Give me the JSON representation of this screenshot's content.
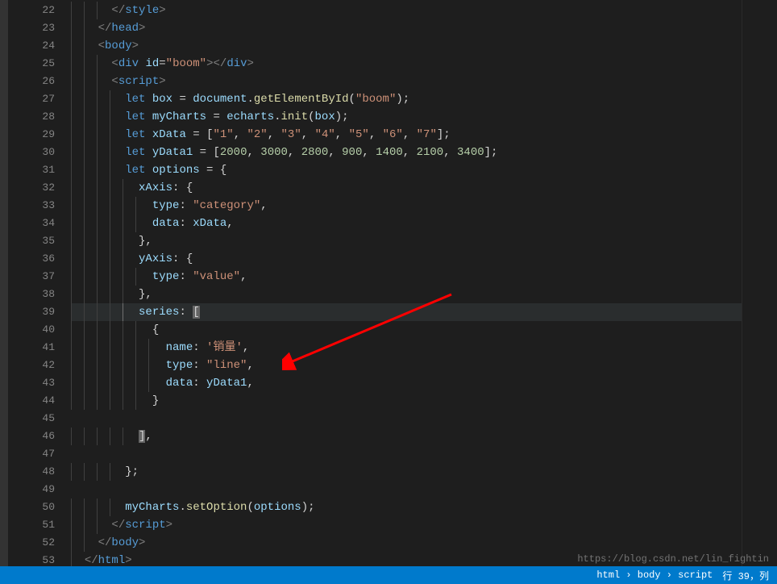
{
  "lines": [
    {
      "num": 22,
      "indent": 3,
      "tokens": [
        {
          "t": "tag",
          "v": "</"
        },
        {
          "t": "tagname",
          "v": "style"
        },
        {
          "t": "tag",
          "v": ">"
        }
      ]
    },
    {
      "num": 23,
      "indent": 2,
      "tokens": [
        {
          "t": "tag",
          "v": "</"
        },
        {
          "t": "tagname",
          "v": "head"
        },
        {
          "t": "tag",
          "v": ">"
        }
      ]
    },
    {
      "num": 24,
      "indent": 2,
      "tokens": [
        {
          "t": "tag",
          "v": "<"
        },
        {
          "t": "tagname",
          "v": "body"
        },
        {
          "t": "tag",
          "v": ">"
        }
      ]
    },
    {
      "num": 25,
      "indent": 3,
      "tokens": [
        {
          "t": "tag",
          "v": "<"
        },
        {
          "t": "tagname",
          "v": "div"
        },
        {
          "t": "punct",
          "v": " "
        },
        {
          "t": "attr",
          "v": "id"
        },
        {
          "t": "punct",
          "v": "="
        },
        {
          "t": "string",
          "v": "\"boom\""
        },
        {
          "t": "tag",
          "v": "></"
        },
        {
          "t": "tagname",
          "v": "div"
        },
        {
          "t": "tag",
          "v": ">"
        }
      ]
    },
    {
      "num": 26,
      "indent": 3,
      "tokens": [
        {
          "t": "tag",
          "v": "<"
        },
        {
          "t": "tagname",
          "v": "script"
        },
        {
          "t": "tag",
          "v": ">"
        }
      ]
    },
    {
      "num": 27,
      "indent": 4,
      "tokens": [
        {
          "t": "keyword",
          "v": "let"
        },
        {
          "t": "punct",
          "v": " "
        },
        {
          "t": "var",
          "v": "box"
        },
        {
          "t": "punct",
          "v": " = "
        },
        {
          "t": "var",
          "v": "document"
        },
        {
          "t": "punct",
          "v": "."
        },
        {
          "t": "func",
          "v": "getElementById"
        },
        {
          "t": "punct",
          "v": "("
        },
        {
          "t": "string",
          "v": "\"boom\""
        },
        {
          "t": "punct",
          "v": ");"
        }
      ]
    },
    {
      "num": 28,
      "indent": 4,
      "tokens": [
        {
          "t": "keyword",
          "v": "let"
        },
        {
          "t": "punct",
          "v": " "
        },
        {
          "t": "var",
          "v": "myCharts"
        },
        {
          "t": "punct",
          "v": " = "
        },
        {
          "t": "var",
          "v": "echarts"
        },
        {
          "t": "punct",
          "v": "."
        },
        {
          "t": "func",
          "v": "init"
        },
        {
          "t": "punct",
          "v": "("
        },
        {
          "t": "var",
          "v": "box"
        },
        {
          "t": "punct",
          "v": ");"
        }
      ]
    },
    {
      "num": 29,
      "indent": 4,
      "tokens": [
        {
          "t": "keyword",
          "v": "let"
        },
        {
          "t": "punct",
          "v": " "
        },
        {
          "t": "var",
          "v": "xData"
        },
        {
          "t": "punct",
          "v": " = ["
        },
        {
          "t": "string",
          "v": "\"1\""
        },
        {
          "t": "punct",
          "v": ", "
        },
        {
          "t": "string",
          "v": "\"2\""
        },
        {
          "t": "punct",
          "v": ", "
        },
        {
          "t": "string",
          "v": "\"3\""
        },
        {
          "t": "punct",
          "v": ", "
        },
        {
          "t": "string",
          "v": "\"4\""
        },
        {
          "t": "punct",
          "v": ", "
        },
        {
          "t": "string",
          "v": "\"5\""
        },
        {
          "t": "punct",
          "v": ", "
        },
        {
          "t": "string",
          "v": "\"6\""
        },
        {
          "t": "punct",
          "v": ", "
        },
        {
          "t": "string",
          "v": "\"7\""
        },
        {
          "t": "punct",
          "v": "];"
        }
      ]
    },
    {
      "num": 30,
      "indent": 4,
      "tokens": [
        {
          "t": "keyword",
          "v": "let"
        },
        {
          "t": "punct",
          "v": " "
        },
        {
          "t": "var",
          "v": "yData1"
        },
        {
          "t": "punct",
          "v": " = ["
        },
        {
          "t": "num",
          "v": "2000"
        },
        {
          "t": "punct",
          "v": ", "
        },
        {
          "t": "num",
          "v": "3000"
        },
        {
          "t": "punct",
          "v": ", "
        },
        {
          "t": "num",
          "v": "2800"
        },
        {
          "t": "punct",
          "v": ", "
        },
        {
          "t": "num",
          "v": "900"
        },
        {
          "t": "punct",
          "v": ", "
        },
        {
          "t": "num",
          "v": "1400"
        },
        {
          "t": "punct",
          "v": ", "
        },
        {
          "t": "num",
          "v": "2100"
        },
        {
          "t": "punct",
          "v": ", "
        },
        {
          "t": "num",
          "v": "3400"
        },
        {
          "t": "punct",
          "v": "];"
        }
      ]
    },
    {
      "num": 31,
      "indent": 4,
      "tokens": [
        {
          "t": "keyword",
          "v": "let"
        },
        {
          "t": "punct",
          "v": " "
        },
        {
          "t": "var",
          "v": "options"
        },
        {
          "t": "punct",
          "v": " = {"
        }
      ]
    },
    {
      "num": 32,
      "indent": 5,
      "tokens": [
        {
          "t": "prop",
          "v": "xAxis"
        },
        {
          "t": "punct",
          "v": ": {"
        }
      ]
    },
    {
      "num": 33,
      "indent": 6,
      "tokens": [
        {
          "t": "prop",
          "v": "type"
        },
        {
          "t": "punct",
          "v": ": "
        },
        {
          "t": "string",
          "v": "\"category\""
        },
        {
          "t": "punct",
          "v": ","
        }
      ]
    },
    {
      "num": 34,
      "indent": 6,
      "tokens": [
        {
          "t": "prop",
          "v": "data"
        },
        {
          "t": "punct",
          "v": ": "
        },
        {
          "t": "var",
          "v": "xData"
        },
        {
          "t": "punct",
          "v": ","
        }
      ]
    },
    {
      "num": 35,
      "indent": 5,
      "tokens": [
        {
          "t": "punct",
          "v": "},"
        }
      ]
    },
    {
      "num": 36,
      "indent": 5,
      "tokens": [
        {
          "t": "prop",
          "v": "yAxis"
        },
        {
          "t": "punct",
          "v": ": {"
        }
      ]
    },
    {
      "num": 37,
      "indent": 6,
      "tokens": [
        {
          "t": "prop",
          "v": "type"
        },
        {
          "t": "punct",
          "v": ": "
        },
        {
          "t": "string",
          "v": "\"value\""
        },
        {
          "t": "punct",
          "v": ","
        }
      ]
    },
    {
      "num": 38,
      "indent": 5,
      "tokens": [
        {
          "t": "punct",
          "v": "},"
        }
      ]
    },
    {
      "num": 39,
      "indent": 5,
      "highlighted": true,
      "tokens": [
        {
          "t": "prop",
          "v": "series"
        },
        {
          "t": "punct",
          "v": ": "
        },
        {
          "t": "bracket-hl",
          "v": "["
        }
      ]
    },
    {
      "num": 40,
      "indent": 6,
      "tokens": [
        {
          "t": "punct",
          "v": "{"
        }
      ]
    },
    {
      "num": 41,
      "indent": 7,
      "tokens": [
        {
          "t": "prop",
          "v": "name"
        },
        {
          "t": "punct",
          "v": ": "
        },
        {
          "t": "string",
          "v": "'销量'"
        },
        {
          "t": "punct",
          "v": ","
        }
      ]
    },
    {
      "num": 42,
      "indent": 7,
      "tokens": [
        {
          "t": "prop",
          "v": "type"
        },
        {
          "t": "punct",
          "v": ": "
        },
        {
          "t": "string",
          "v": "\"line\""
        },
        {
          "t": "punct",
          "v": ","
        }
      ]
    },
    {
      "num": 43,
      "indent": 7,
      "tokens": [
        {
          "t": "prop",
          "v": "data"
        },
        {
          "t": "punct",
          "v": ": "
        },
        {
          "t": "var",
          "v": "yData1"
        },
        {
          "t": "punct",
          "v": ","
        }
      ]
    },
    {
      "num": 44,
      "indent": 6,
      "tokens": [
        {
          "t": "punct",
          "v": "}"
        }
      ]
    },
    {
      "num": 45,
      "indent": 0,
      "tokens": []
    },
    {
      "num": 46,
      "indent": 5,
      "tokens": [
        {
          "t": "bracket-hl",
          "v": "]"
        },
        {
          "t": "punct",
          "v": ","
        }
      ]
    },
    {
      "num": 47,
      "indent": 0,
      "tokens": []
    },
    {
      "num": 48,
      "indent": 4,
      "tokens": [
        {
          "t": "punct",
          "v": "};"
        }
      ]
    },
    {
      "num": 49,
      "indent": 0,
      "tokens": []
    },
    {
      "num": 50,
      "indent": 4,
      "tokens": [
        {
          "t": "var",
          "v": "myCharts"
        },
        {
          "t": "punct",
          "v": "."
        },
        {
          "t": "func",
          "v": "setOption"
        },
        {
          "t": "punct",
          "v": "("
        },
        {
          "t": "var",
          "v": "options"
        },
        {
          "t": "punct",
          "v": ");"
        }
      ]
    },
    {
      "num": 51,
      "indent": 3,
      "tokens": [
        {
          "t": "tag",
          "v": "</"
        },
        {
          "t": "tagname",
          "v": "script"
        },
        {
          "t": "tag",
          "v": ">"
        }
      ]
    },
    {
      "num": 52,
      "indent": 2,
      "tokens": [
        {
          "t": "tag",
          "v": "</"
        },
        {
          "t": "tagname",
          "v": "body"
        },
        {
          "t": "tag",
          "v": ">"
        }
      ]
    },
    {
      "num": 53,
      "indent": 1,
      "tokens": [
        {
          "t": "tag",
          "v": "</"
        },
        {
          "t": "tagname",
          "v": "html"
        },
        {
          "t": "tag",
          "v": ">"
        }
      ]
    }
  ],
  "watermark": "https://blog.csdn.net/lin_fightin",
  "status": {
    "breadcrumb": "html › body › script",
    "cursor": "行 39，列"
  },
  "arrow": {
    "color": "#ff0000"
  }
}
